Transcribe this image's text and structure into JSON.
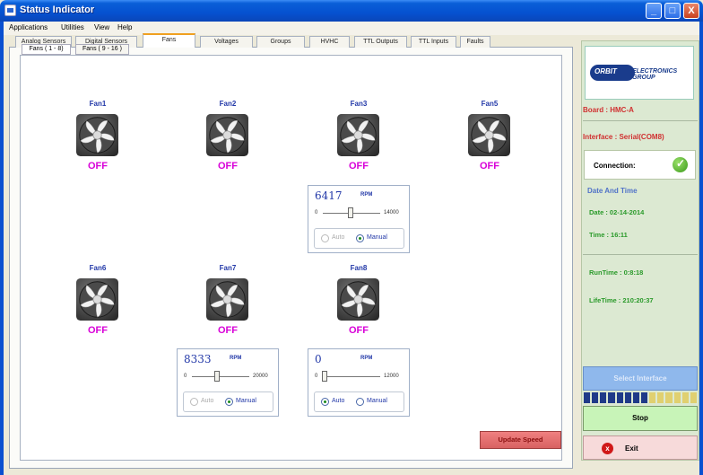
{
  "window": {
    "title": "Status Indicator",
    "min_label": "_",
    "max_label": "□",
    "close_label": "X"
  },
  "menu": [
    "Applications",
    "Utilities",
    "View",
    "Help"
  ],
  "tabs": [
    "Analog Sensors",
    "Digital Sensors",
    "Fans",
    "Voltages",
    "Groups",
    "HVHC",
    "TTL Outputs",
    "TTL Inputs",
    "Faults"
  ],
  "active_tab": "Fans",
  "subtabs": [
    "Fans ( 1 - 8)",
    "Fans ( 9 - 16 )"
  ],
  "fans": [
    {
      "name": "Fan1",
      "status": "OFF"
    },
    {
      "name": "Fan2",
      "status": "OFF"
    },
    {
      "name": "Fan3",
      "status": "OFF"
    },
    {
      "name": "Fan5",
      "status": "OFF"
    },
    {
      "name": "Fan6",
      "status": "OFF"
    },
    {
      "name": "Fan7",
      "status": "OFF"
    },
    {
      "name": "Fan8",
      "status": "OFF"
    }
  ],
  "rpm_controls": [
    {
      "value": "6417",
      "unit": "RPM",
      "min": "0",
      "max": "14000",
      "slider_fraction": 0.458,
      "auto_label": "Auto",
      "manual_label": "Manual",
      "mode": "Manual",
      "auto_enabled": false
    },
    {
      "value": "8333",
      "unit": "RPM",
      "min": "0",
      "max": "20000",
      "slider_fraction": 0.417,
      "auto_label": "Auto",
      "manual_label": "Manual",
      "mode": "Manual",
      "auto_enabled": false
    },
    {
      "value": "0",
      "unit": "RPM",
      "min": "0",
      "max": "12000",
      "slider_fraction": 0.0,
      "auto_label": "Auto",
      "manual_label": "Manual",
      "mode": "Auto",
      "auto_enabled": true
    }
  ],
  "update_button": "Update Speed",
  "side": {
    "logo_badge": "ORBIT",
    "logo_text": "ELECTRONICS GROUP",
    "board": "Board : HMC-A",
    "interface": "Interface  : Serial(COM8)",
    "connection_label": "Connection:",
    "datetime_heading": "Date And Time",
    "date": "Date  :  02-14-2014",
    "time": "Time  :  16:11",
    "runtime": "RunTime  :  0:8:18",
    "lifetime": "LifeTime  :  210:20:37",
    "select_interface": "Select Interface",
    "stop": "Stop",
    "exit": "Exit",
    "exit_icon": "x"
  },
  "colors": {
    "fan_name": "#2238a8",
    "status_off": "#d800d8",
    "accent_red": "#d03030",
    "accent_green": "#2a9a2a"
  }
}
